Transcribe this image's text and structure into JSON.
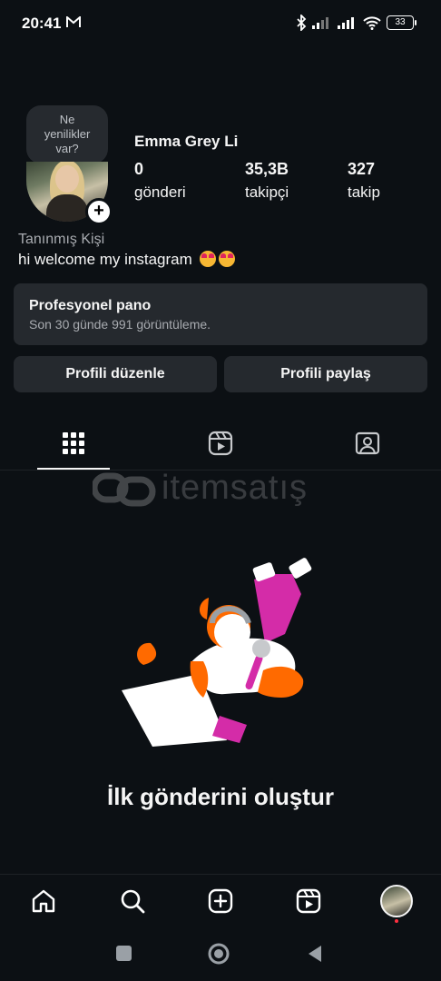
{
  "status_bar": {
    "time": "20:41",
    "battery": "33"
  },
  "profile": {
    "whats_new": [
      "Ne",
      "yenilikler",
      "var?"
    ],
    "username": "Emma Grey Li",
    "stats": [
      {
        "value": "0",
        "label": "gönderi"
      },
      {
        "value": "35,3B",
        "label": "takipçi"
      },
      {
        "value": "327",
        "label": "takip"
      }
    ],
    "category": "Tanınmış Kişi",
    "bio": "hi welcome my instagram"
  },
  "dashboard": {
    "title": "Profesyonel pano",
    "subtitle": "Son 30 günde 991 görüntüleme."
  },
  "buttons": {
    "edit": "Profili düzenle",
    "share": "Profili paylaş"
  },
  "watermark": "itemsatış",
  "empty_state": {
    "title": "İlk gönderini oluştur"
  },
  "colors": {
    "background": "#0c1014",
    "surface": "#25292e",
    "accent_pink": "#d42ca8",
    "accent_orange": "#ff6a00"
  },
  "tabs": [
    "grid-icon",
    "reels-icon",
    "tagged-icon"
  ],
  "bottom_nav": [
    "home-icon",
    "search-icon",
    "create-icon",
    "reels-icon",
    "profile-avatar"
  ]
}
